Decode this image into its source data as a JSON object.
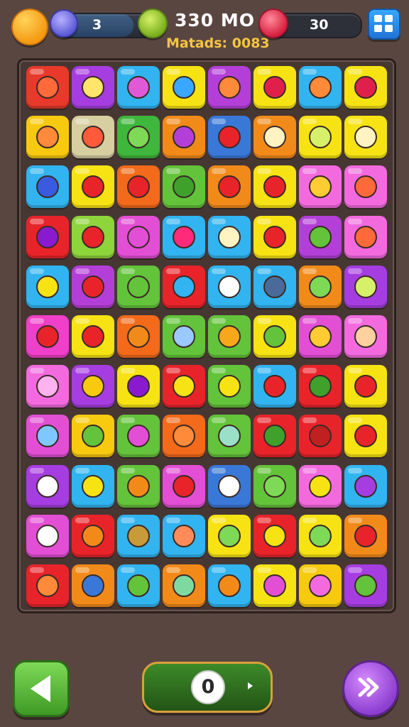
{
  "header": {
    "moves_value": "3",
    "score_text": "330 MO",
    "subtitle_text": "Matads: 0083",
    "lives_value": "30",
    "icons": {
      "coin": "orange-fruit-icon",
      "moves": "moves-face-icon",
      "score": "leaf-icon",
      "lives": "heart-icon",
      "menu": "grid-menu-icon"
    }
  },
  "board": {
    "rows": 11,
    "cols": 8,
    "tiles": [
      [
        "#e8392a",
        "#a63de0",
        "#31b4f0",
        "#f7e313",
        "#b43fd8",
        "#f7e313",
        "#31b4f0",
        "#f7e313"
      ],
      [
        "#f7c90f",
        "#d7cfa0",
        "#3fb63c",
        "#f28a1a",
        "#3a78d8",
        "#f28a1a",
        "#f7e313",
        "#f7e313"
      ],
      [
        "#31b4f0",
        "#f7e313",
        "#f26a1a",
        "#63c33a",
        "#f28a1a",
        "#f7e313",
        "#f36adf",
        "#f36adf"
      ],
      [
        "#e8242a",
        "#8ed43b",
        "#e24fd5",
        "#31b4f0",
        "#31b4f0",
        "#f7e313",
        "#b43fd8",
        "#f36adf"
      ],
      [
        "#31b4f0",
        "#b43fd8",
        "#63c33a",
        "#e8242a",
        "#31b4f0",
        "#31b4f0",
        "#f28a1a",
        "#a63de0"
      ],
      [
        "#f03fc8",
        "#f7e313",
        "#f26a1a",
        "#63c33a",
        "#63c33a",
        "#f7e313",
        "#e24fd5",
        "#f36adf"
      ],
      [
        "#f36adf",
        "#a63de0",
        "#f7e313",
        "#e8242a",
        "#63c33a",
        "#31b4f0",
        "#e8242a",
        "#f7e313"
      ],
      [
        "#e24fd5",
        "#f7c90f",
        "#63c33a",
        "#f26a1a",
        "#63c33a",
        "#e8242a",
        "#e8242a",
        "#f7e313"
      ],
      [
        "#a63de0",
        "#31b4f0",
        "#63c33a",
        "#e24fd5",
        "#3a78d8",
        "#63c33a",
        "#f36adf",
        "#31b4f0"
      ],
      [
        "#e24fd5",
        "#e8242a",
        "#31b4f0",
        "#31b4f0",
        "#f7e313",
        "#e8242a",
        "#f7e313",
        "#f28a1a"
      ],
      [
        "#e8242a",
        "#f28a1a",
        "#31b4f0",
        "#f28a1a",
        "#31b4f0",
        "#f7e313",
        "#f7c90f",
        "#a63de0"
      ]
    ],
    "glyphs": [
      [
        "#ff6a3a",
        "#ffe56a",
        "#e05ad8",
        "#3aa7ff",
        "#ff8a3a",
        "#e0204a",
        "#ff8a3a",
        "#e0204a"
      ],
      [
        "#ff8a3a",
        "#ff5a3a",
        "#7ed957",
        "#b43fd8",
        "#e8242a",
        "#fff3c2",
        "#d7f06a",
        "#fff3c2"
      ],
      [
        "#3a5ae0",
        "#e8242a",
        "#e8242a",
        "#3fa02c",
        "#e8242a",
        "#e8242a",
        "#ffcc33",
        "#ff6a3a"
      ],
      [
        "#8a1ad0",
        "#e8242a",
        "#e24fd5",
        "#ff2a7a",
        "#fff3c2",
        "#e8242a",
        "#63c33a",
        "#ff6a3a"
      ],
      [
        "#f7e313",
        "#e8242a",
        "#63c33a",
        "#31b4f0",
        "#ffffff",
        "#4a6a9a",
        "#7ed957",
        "#d7f06a"
      ],
      [
        "#e8242a",
        "#e8242a",
        "#f28a1a",
        "#9ac8ff",
        "#f7a81a",
        "#63c33a",
        "#ffcc33",
        "#ffd0a0"
      ],
      [
        "#ffb2f0",
        "#f7c90f",
        "#8a1ad0",
        "#f7e313",
        "#f7e313",
        "#e8242a",
        "#3fa02c",
        "#e8242a"
      ],
      [
        "#7ec8ff",
        "#63c33a",
        "#e24fd5",
        "#ff8a3a",
        "#9ae0c8",
        "#3fa02c",
        "#c02020",
        "#e8242a"
      ],
      [
        "#ffffff",
        "#f7e313",
        "#f28a1a",
        "#e8242a",
        "#ffffff",
        "#7ed957",
        "#f7e313",
        "#a63de0"
      ],
      [
        "#ffffff",
        "#f28a1a",
        "#c89a3a",
        "#ff8a5a",
        "#7ed957",
        "#f7e313",
        "#7ed957",
        "#e8242a"
      ],
      [
        "#ff8a3a",
        "#3a78d8",
        "#63c33a",
        "#7ed9a0",
        "#f28a1a",
        "#e24fd5",
        "#f36adf",
        "#63c33a"
      ]
    ]
  },
  "footer": {
    "back_icon": "triangle-left-icon",
    "center_value": "0",
    "skip_icon": "fast-forward-icon"
  }
}
